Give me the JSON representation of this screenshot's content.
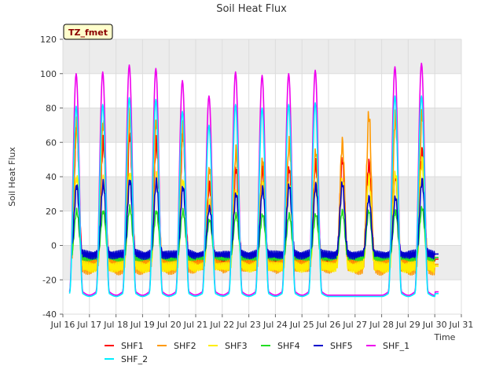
{
  "chart_data": {
    "type": "line",
    "title": "Soil Heat Flux",
    "xlabel": "Time",
    "ylabel": "Soil Heat Flux",
    "ylim": [
      -40,
      120
    ],
    "xlim": [
      16,
      31
    ],
    "grid": true,
    "legend_position": "bottom",
    "annotation": "TZ_fmet",
    "x_ticks": [
      "Jul 16",
      "Jul 17",
      "Jul 18",
      "Jul 19",
      "Jul 20",
      "Jul 21",
      "Jul 22",
      "Jul 23",
      "Jul 24",
      "Jul 25",
      "Jul 26",
      "Jul 27",
      "Jul 28",
      "Jul 29",
      "Jul 30",
      "Jul 31"
    ],
    "y_ticks": [
      -40,
      -20,
      0,
      20,
      40,
      60,
      80,
      100,
      120
    ],
    "series": [
      {
        "name": "SHF1",
        "color": "#ff0000",
        "base": -8,
        "peaks": [
          70,
          60,
          65,
          60,
          65,
          35,
          45,
          45,
          45,
          48,
          50,
          48,
          40,
          55,
          55
        ]
      },
      {
        "name": "SHF2",
        "color": "#ff9900",
        "base": -11,
        "peaks": [
          70,
          72,
          75,
          73,
          68,
          45,
          55,
          50,
          60,
          55,
          60,
          76,
          76,
          77,
          80
        ]
      },
      {
        "name": "SHF3",
        "color": "#ffee00",
        "base": -12,
        "peaks": [
          40,
          38,
          42,
          40,
          38,
          25,
          32,
          35,
          36,
          35,
          38,
          40,
          42,
          50,
          50
        ]
      },
      {
        "name": "SHF4",
        "color": "#22dd22",
        "base": -7,
        "peaks": [
          20,
          20,
          22,
          20,
          20,
          15,
          18,
          18,
          18,
          18,
          20,
          20,
          20,
          22,
          22
        ]
      },
      {
        "name": "SHF5",
        "color": "#0000cc",
        "base": -5,
        "peaks": [
          35,
          36,
          38,
          37,
          34,
          22,
          30,
          33,
          35,
          35,
          36,
          28,
          28,
          38,
          38
        ]
      },
      {
        "name": "SHF_1",
        "color": "#ee00ee",
        "base": -27,
        "peaks": [
          100,
          101,
          105,
          103,
          96,
          87,
          101,
          99,
          100,
          102,
          null,
          null,
          104,
          106,
          0
        ]
      },
      {
        "name": "SHF_2",
        "color": "#00eeff",
        "base": -28,
        "peaks": [
          81,
          82,
          86,
          85,
          78,
          70,
          82,
          80,
          82,
          83,
          null,
          null,
          87,
          87,
          0
        ]
      }
    ]
  }
}
